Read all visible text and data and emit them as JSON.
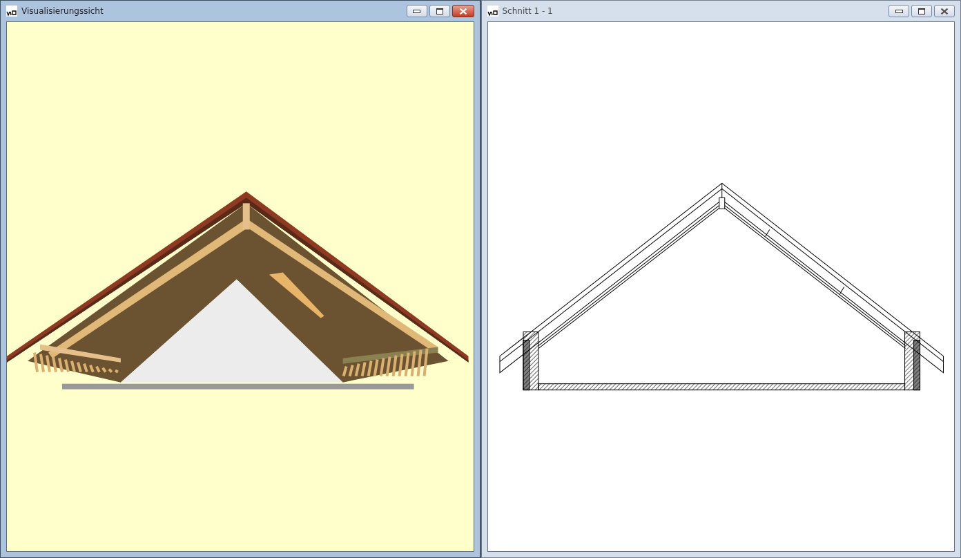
{
  "windows": [
    {
      "title": "Visualisierungssicht",
      "active": true,
      "kind": "render"
    },
    {
      "title": "Schnitt 1 - 1",
      "active": false,
      "kind": "section"
    }
  ]
}
